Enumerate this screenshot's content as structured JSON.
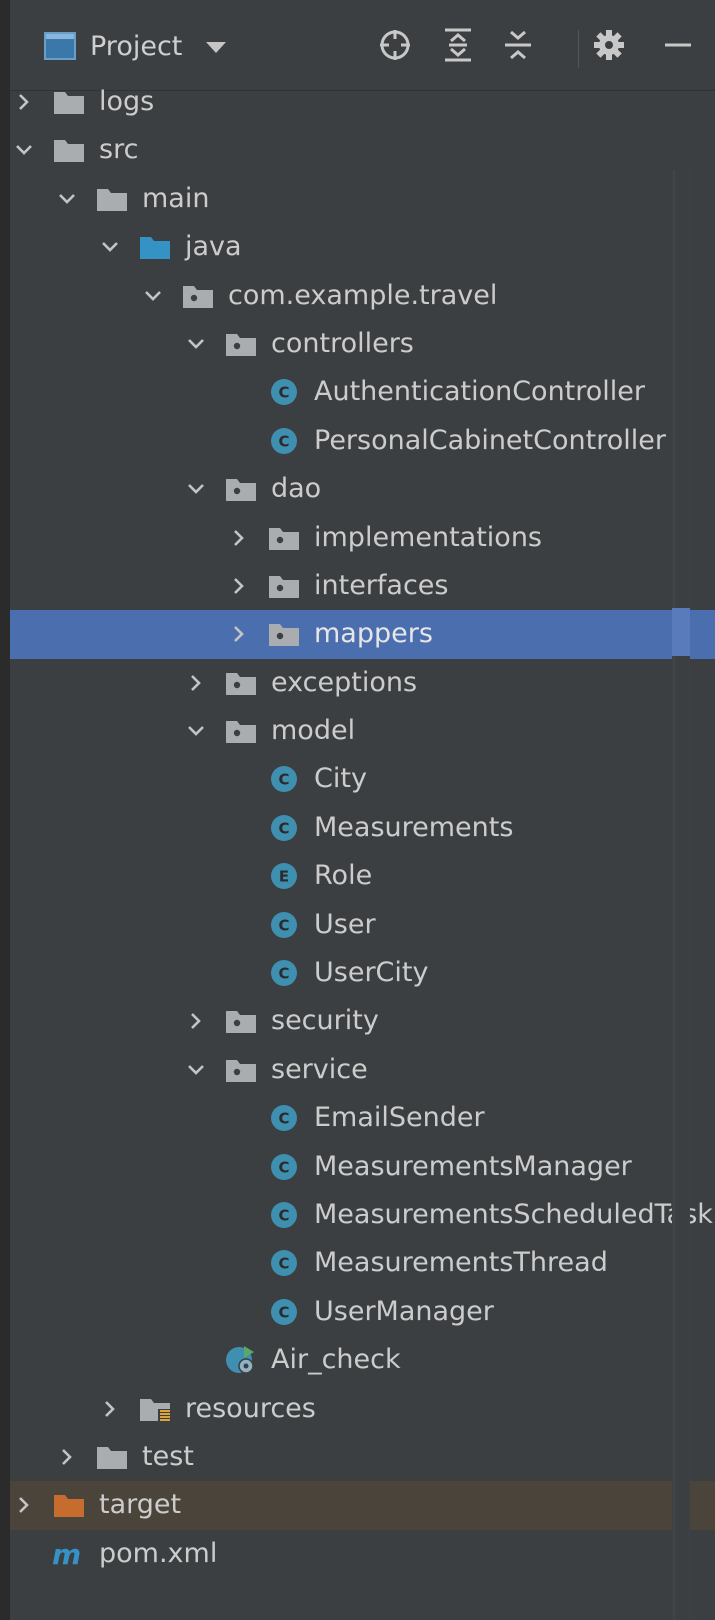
{
  "toolbar": {
    "title": "Project",
    "icons": [
      "project-window-icon",
      "caret-down-icon",
      "locate-icon",
      "expand-all-icon",
      "collapse-all-icon",
      "gear-icon",
      "minimize-icon"
    ]
  },
  "colors": {
    "background": "#3c3f41",
    "selection": "#4b6eaf",
    "excluded_row": "#4a443a",
    "class_icon": "#3e8fb0",
    "source_folder": "#3592c4",
    "excluded_folder": "#c56c2e",
    "text": "#cccccc"
  },
  "tree": [
    {
      "label": "logs",
      "depth": 0,
      "chevron": "right",
      "icon": "folder-icon"
    },
    {
      "label": "src",
      "depth": 0,
      "chevron": "down",
      "icon": "folder-icon"
    },
    {
      "label": "main",
      "depth": 1,
      "chevron": "down",
      "icon": "folder-icon"
    },
    {
      "label": "java",
      "depth": 2,
      "chevron": "down",
      "icon": "source-folder-icon"
    },
    {
      "label": "com.example.travel",
      "depth": 3,
      "chevron": "down",
      "icon": "package-icon"
    },
    {
      "label": "controllers",
      "depth": 4,
      "chevron": "down",
      "icon": "package-icon"
    },
    {
      "label": "AuthenticationController",
      "depth": 5,
      "chevron": "",
      "icon": "class-icon"
    },
    {
      "label": "PersonalCabinetController",
      "depth": 5,
      "chevron": "",
      "icon": "class-icon"
    },
    {
      "label": "dao",
      "depth": 4,
      "chevron": "down",
      "icon": "package-icon"
    },
    {
      "label": "implementations",
      "depth": 5,
      "chevron": "right",
      "icon": "package-icon"
    },
    {
      "label": "interfaces",
      "depth": 5,
      "chevron": "right",
      "icon": "package-icon"
    },
    {
      "label": "mappers",
      "depth": 5,
      "chevron": "right",
      "icon": "package-icon",
      "selected": true
    },
    {
      "label": "exceptions",
      "depth": 4,
      "chevron": "right",
      "icon": "package-icon"
    },
    {
      "label": "model",
      "depth": 4,
      "chevron": "down",
      "icon": "package-icon"
    },
    {
      "label": "City",
      "depth": 5,
      "chevron": "",
      "icon": "class-icon"
    },
    {
      "label": "Measurements",
      "depth": 5,
      "chevron": "",
      "icon": "class-icon"
    },
    {
      "label": "Role",
      "depth": 5,
      "chevron": "",
      "icon": "enum-icon"
    },
    {
      "label": "User",
      "depth": 5,
      "chevron": "",
      "icon": "class-icon"
    },
    {
      "label": "UserCity",
      "depth": 5,
      "chevron": "",
      "icon": "class-icon"
    },
    {
      "label": "security",
      "depth": 4,
      "chevron": "right",
      "icon": "package-icon"
    },
    {
      "label": "service",
      "depth": 4,
      "chevron": "down",
      "icon": "package-icon"
    },
    {
      "label": "EmailSender",
      "depth": 5,
      "chevron": "",
      "icon": "class-icon"
    },
    {
      "label": "MeasurementsManager",
      "depth": 5,
      "chevron": "",
      "icon": "class-icon"
    },
    {
      "label": "MeasurementsScheduledTask",
      "depth": 5,
      "chevron": "",
      "icon": "class-icon"
    },
    {
      "label": "MeasurementsThread",
      "depth": 5,
      "chevron": "",
      "icon": "class-icon"
    },
    {
      "label": "UserManager",
      "depth": 5,
      "chevron": "",
      "icon": "class-icon"
    },
    {
      "label": "Air_check",
      "depth": 4,
      "chevron": "",
      "icon": "spring-boot-app-icon"
    },
    {
      "label": "resources",
      "depth": 2,
      "chevron": "right",
      "icon": "resources-folder-icon"
    },
    {
      "label": "test",
      "depth": 1,
      "chevron": "right",
      "icon": "folder-icon"
    },
    {
      "label": "target",
      "depth": 0,
      "chevron": "right",
      "icon": "excluded-folder-icon",
      "excluded": true
    },
    {
      "label": "pom.xml",
      "depth": 0,
      "chevron": "",
      "icon": "maven-icon"
    }
  ]
}
